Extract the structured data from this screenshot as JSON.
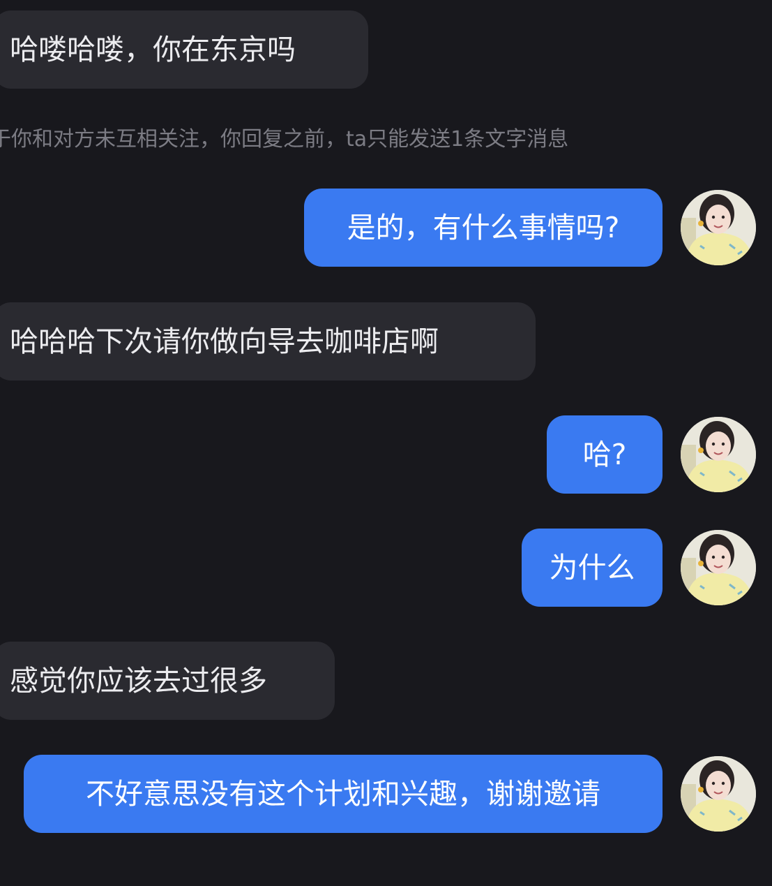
{
  "conversation": {
    "messages": [
      {
        "direction": "incoming",
        "text": "哈喽哈喽，你在东京吗"
      },
      {
        "direction": "outgoing",
        "text": "是的，有什么事情吗?"
      },
      {
        "direction": "incoming",
        "text": "哈哈哈下次请你做向导去咖啡店啊"
      },
      {
        "direction": "outgoing",
        "text": "哈?"
      },
      {
        "direction": "outgoing",
        "text": "为什么"
      },
      {
        "direction": "incoming",
        "text": "感觉你应该去过很多"
      },
      {
        "direction": "outgoing",
        "text": "不好意思没有这个计划和兴趣，谢谢邀请"
      }
    ],
    "notice": "于你和对方未互相关注，你回复之前，ta只能发送1条文字消息"
  },
  "icons": {
    "avatar": "user-avatar-photo"
  },
  "colors": {
    "background": "#18181d",
    "incoming_bubble": "#2a2a30",
    "outgoing_bubble": "#3a7af1",
    "notice_text": "#7c7c84"
  }
}
